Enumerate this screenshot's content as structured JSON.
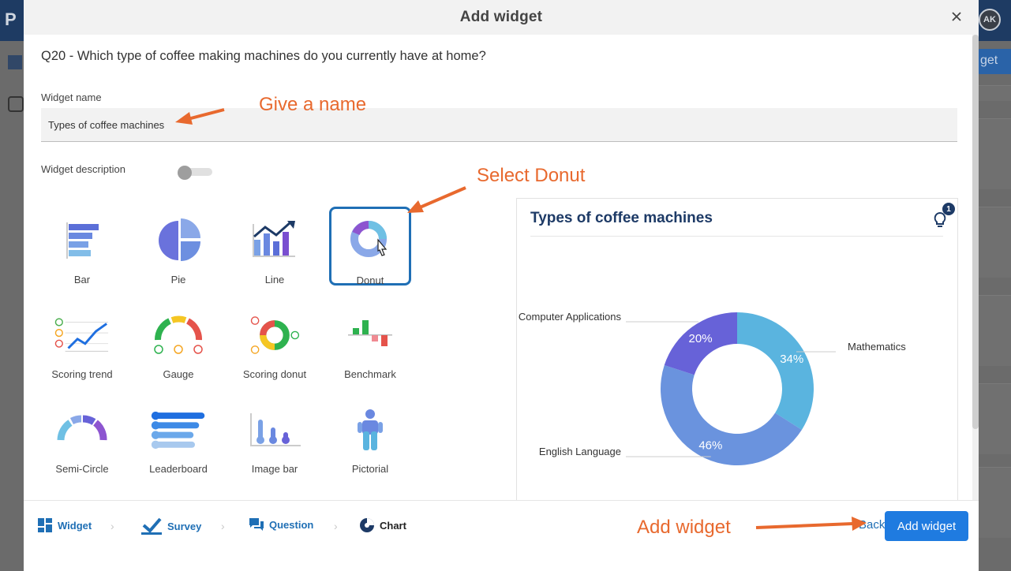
{
  "background": {
    "logo": "P",
    "avatar_initials": "AK",
    "right_button_fragment": "get"
  },
  "modal": {
    "title": "Add widget",
    "question": "Q20 - Which type of coffee making machines do you currently have at home?",
    "widget_name_label": "Widget name",
    "widget_name_value": "Types of coffee machines",
    "widget_description_label": "Widget description",
    "widget_description_enabled": false
  },
  "chart_types": [
    {
      "label": "Bar",
      "icon": "bar-chart-icon"
    },
    {
      "label": "Pie",
      "icon": "pie-chart-icon"
    },
    {
      "label": "Line",
      "icon": "line-chart-icon"
    },
    {
      "label": "Donut",
      "icon": "donut-chart-icon",
      "selected": true
    },
    {
      "label": "Scoring trend",
      "icon": "scoring-trend-icon"
    },
    {
      "label": "Gauge",
      "icon": "gauge-icon"
    },
    {
      "label": "Scoring donut",
      "icon": "scoring-donut-icon"
    },
    {
      "label": "Benchmark",
      "icon": "benchmark-icon"
    },
    {
      "label": "Semi-Circle",
      "icon": "semi-circle-icon"
    },
    {
      "label": "Leaderboard",
      "icon": "leaderboard-icon"
    },
    {
      "label": "Image bar",
      "icon": "image-bar-icon"
    },
    {
      "label": "Pictorial",
      "icon": "pictorial-icon"
    }
  ],
  "preview": {
    "title": "Types of coffee machines",
    "insights_count": "1"
  },
  "chart_data": {
    "type": "pie",
    "donut": true,
    "title": "Types of coffee machines",
    "slices": [
      {
        "label": "Mathematics",
        "value": 34,
        "value_label": "34%",
        "color": "#5ab4df"
      },
      {
        "label": "English Language",
        "value": 46,
        "value_label": "46%",
        "color": "#6a93de"
      },
      {
        "label": "Computer Applications",
        "value": 20,
        "value_label": "20%",
        "color": "#6762d8"
      }
    ]
  },
  "footer": {
    "steps": [
      {
        "label": "Widget",
        "icon": "widget-grid-icon"
      },
      {
        "label": "Survey",
        "icon": "survey-check-icon"
      },
      {
        "label": "Question",
        "icon": "question-chat-icon"
      },
      {
        "label": "Chart",
        "icon": "chart-pie-icon",
        "current": true
      }
    ],
    "back_label": "Back",
    "add_label": "Add widget"
  },
  "annotations": {
    "give_name": "Give a name",
    "select_donut": "Select Donut",
    "add_widget": "Add widget"
  },
  "colors": {
    "primary": "#1f6fb5",
    "button": "#1f7be0",
    "title_navy": "#1d3a66",
    "annotation": "#e8692e"
  }
}
